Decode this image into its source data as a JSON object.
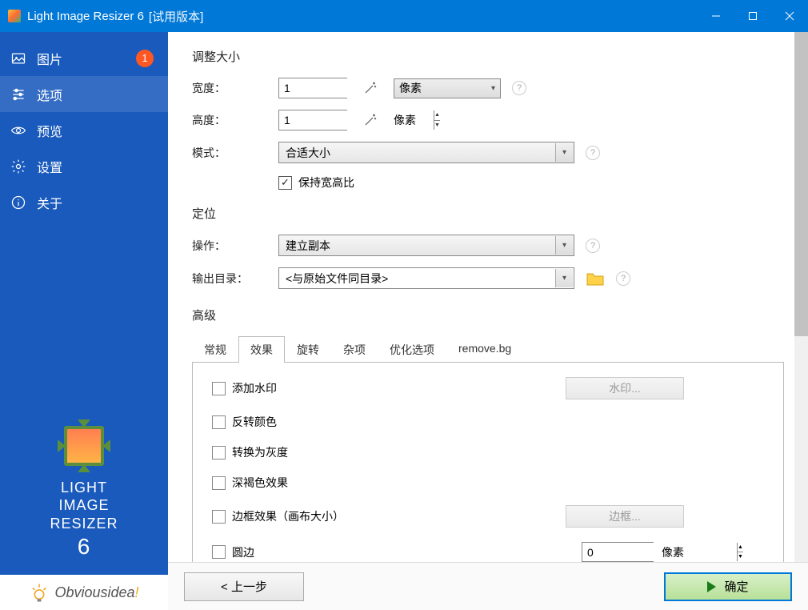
{
  "window": {
    "title": "Light Image Resizer 6",
    "title_suffix": "[试用版本]"
  },
  "sidebar": {
    "items": [
      {
        "label": "图片",
        "badge": "1"
      },
      {
        "label": "选项"
      },
      {
        "label": "预览"
      },
      {
        "label": "设置"
      },
      {
        "label": "关于"
      }
    ],
    "logo_lines": [
      "LIGHT",
      "IMAGE",
      "RESIZER"
    ],
    "logo_version": "6",
    "brand": "Obviousidea",
    "brand_excl": "!"
  },
  "resize": {
    "section": "调整大小",
    "width_label": "宽度：",
    "width_value": "1",
    "width_unit_selected": "像素",
    "height_label": "高度：",
    "height_value": "1",
    "height_unit_text": "像素",
    "mode_label": "模式：",
    "mode_value": "合适大小",
    "keep_ratio_label": "保持宽高比"
  },
  "positioning": {
    "section": "定位",
    "action_label": "操作：",
    "action_value": "建立副本",
    "output_label": "输出目录：",
    "output_value": "<与原始文件同目录>"
  },
  "advanced": {
    "section": "高级",
    "tabs": [
      "常规",
      "效果",
      "旋转",
      "杂项",
      "优化选项",
      "remove.bg"
    ],
    "effects": {
      "watermark": "添加水印",
      "watermark_btn": "水印...",
      "invert": "反转颜色",
      "grayscale": "转换为灰度",
      "sepia": "深褐色效果",
      "border": "边框效果（画布大小）",
      "border_btn": "边框...",
      "rounded": "圆边",
      "rounded_value": "0",
      "rounded_unit": "像素"
    }
  },
  "buttons": {
    "prev": "< 上一步",
    "ok": "确定"
  }
}
